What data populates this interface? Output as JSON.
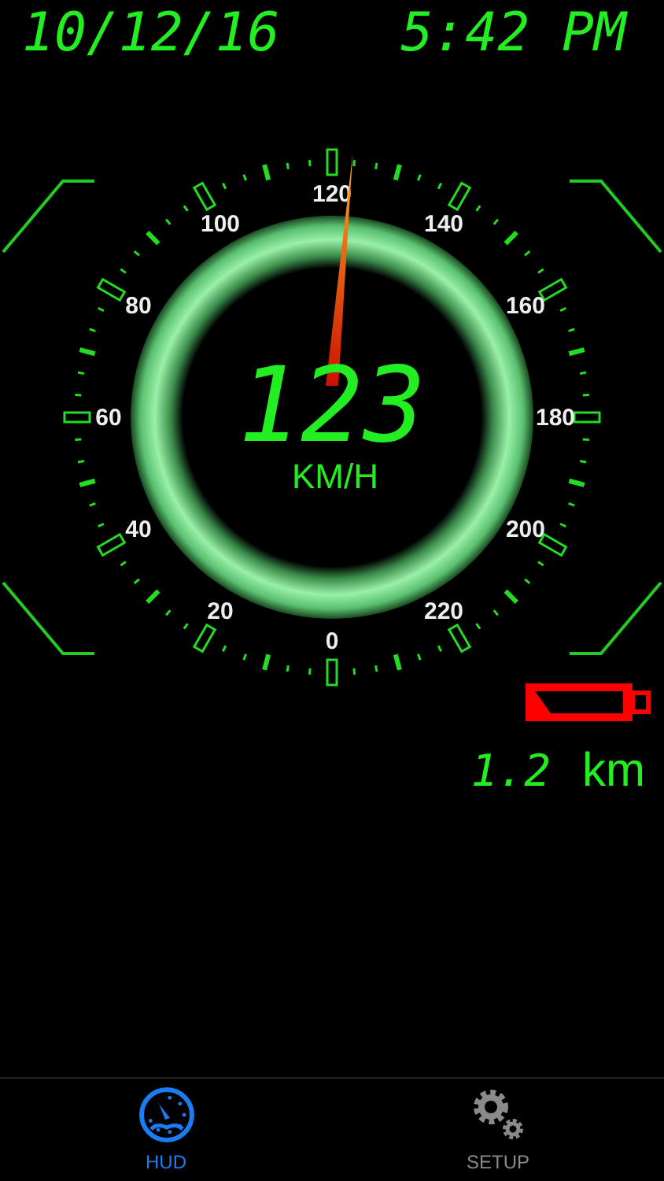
{
  "header": {
    "date": "10/12/16",
    "time": "5:42 PM"
  },
  "gauge": {
    "scale_labels": [
      "0",
      "20",
      "40",
      "60",
      "80",
      "100",
      "120",
      "140",
      "160",
      "180",
      "200",
      "220"
    ],
    "speed": "123",
    "unit": "KM/H"
  },
  "trip": {
    "distance": "1.2",
    "unit": "km"
  },
  "tabs": [
    {
      "label": "HUD",
      "selected": true
    },
    {
      "label": "SETUP",
      "selected": false
    }
  ]
}
